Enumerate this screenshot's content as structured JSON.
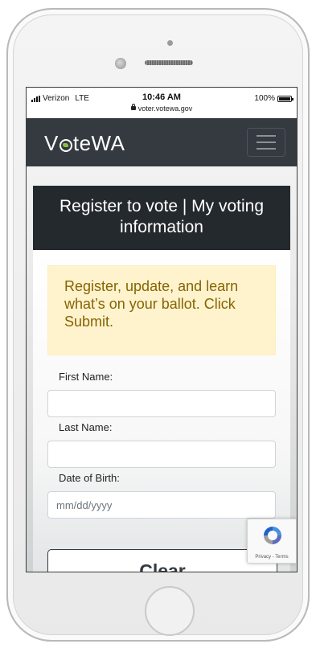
{
  "status_bar": {
    "carrier": "Verizon",
    "network": "LTE",
    "time": "10:46 AM",
    "url": "voter.votewa.gov",
    "battery": "100%",
    "battery_level": 1.0
  },
  "navbar": {
    "brand_prefix": "V",
    "brand_suffix": "teWA",
    "menu_icon": "hamburger-menu-icon"
  },
  "card": {
    "title": "Register to vote | My voting information",
    "alert": "Register, update, and learn what’s on your ballot. Click Submit."
  },
  "form": {
    "first_name_label": "First Name:",
    "first_name_value": "",
    "last_name_label": "Last Name:",
    "last_name_value": "",
    "dob_label": "Date of Birth:",
    "dob_placeholder": "mm/dd/yyyy",
    "clear_label": "Clear"
  },
  "recaptcha": {
    "text": "Privacy - Terms"
  },
  "colors": {
    "navbar": "#343a40",
    "card_header": "#24292e",
    "alert_bg": "#fff3cd",
    "alert_text": "#856404",
    "brand_accent": "#8ac240"
  }
}
